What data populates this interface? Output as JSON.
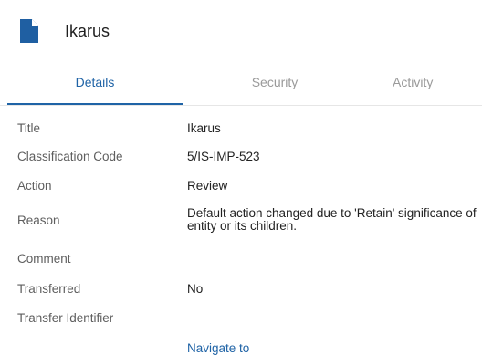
{
  "header": {
    "title": "Ikarus",
    "icon": "document-icon",
    "icon_color": "#1f5fa2"
  },
  "tabs": [
    {
      "label": "Details",
      "active": true
    },
    {
      "label": "Security",
      "active": false
    },
    {
      "label": "Activity",
      "active": false
    }
  ],
  "fields": [
    {
      "label": "Title",
      "value": "Ikarus"
    },
    {
      "label": "Classification Code",
      "value": "5/IS-IMP-523"
    },
    {
      "label": "Action",
      "value": "Review"
    },
    {
      "label": "Reason",
      "value": "Default action changed due to 'Retain' significance of entity or its children."
    },
    {
      "label": "Comment",
      "value": ""
    },
    {
      "label": "Transferred",
      "value": "No"
    },
    {
      "label": "Transfer Identifier",
      "value": ""
    }
  ],
  "navigate_label": "Navigate to",
  "colors": {
    "accent": "#1f63a6",
    "label": "#5e5e5e",
    "inactive_tab": "#9a9a9a"
  }
}
